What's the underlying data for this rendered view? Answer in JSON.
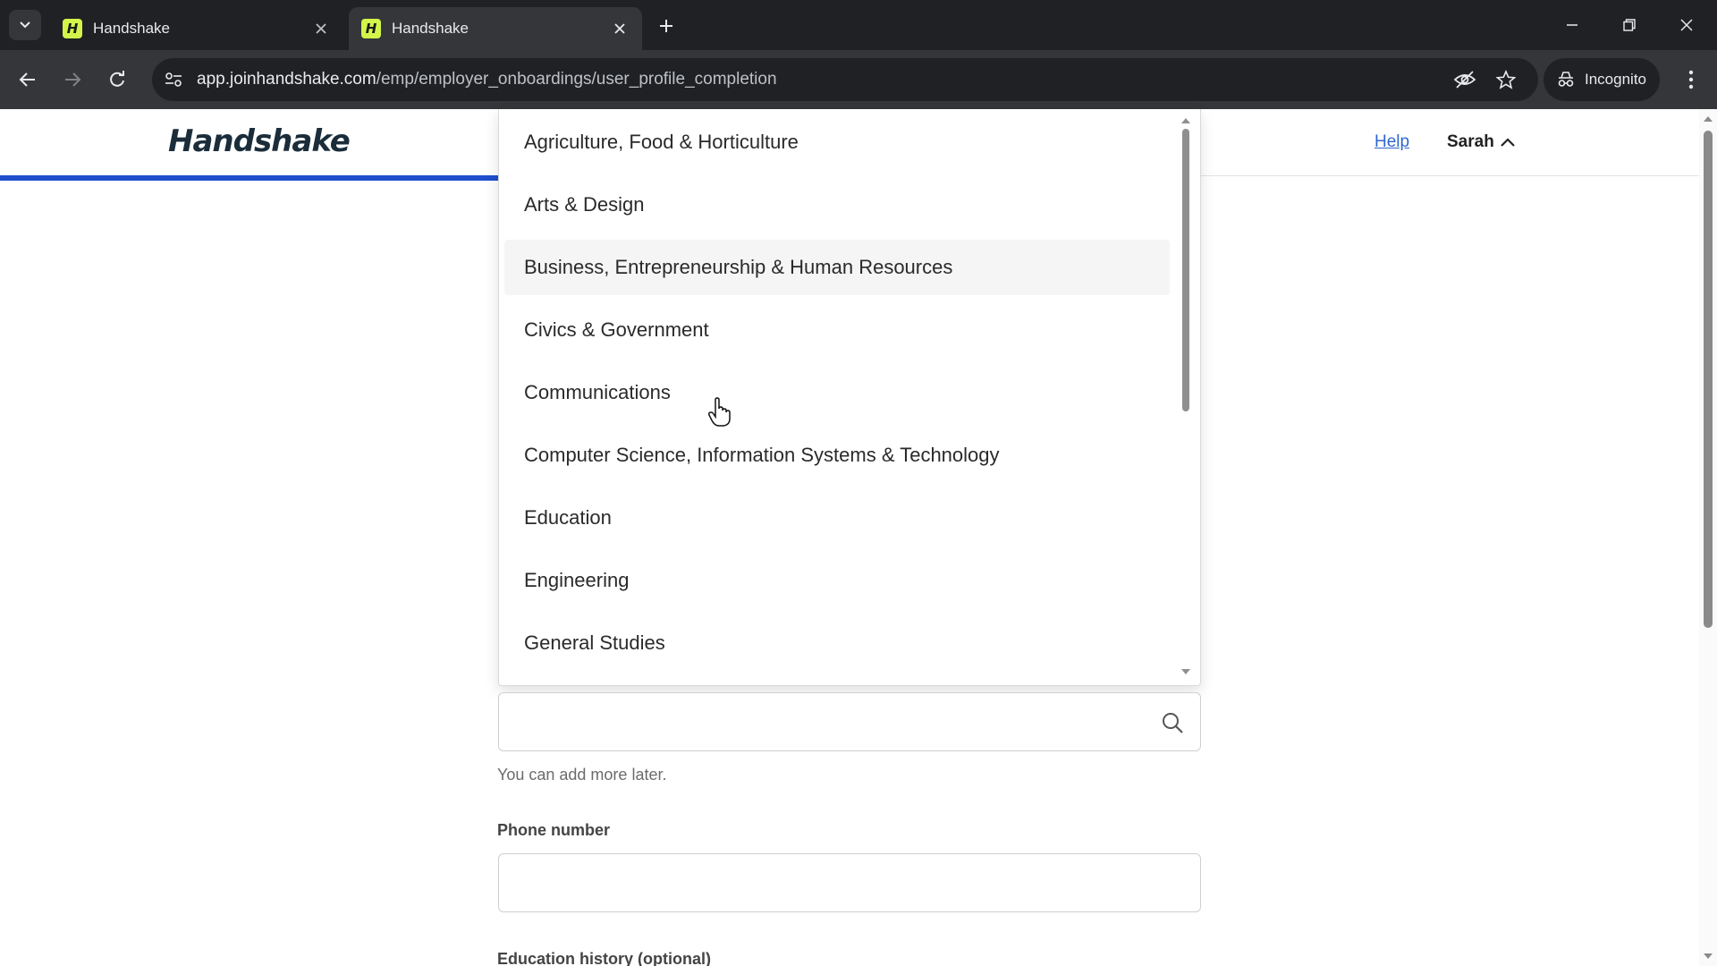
{
  "browser": {
    "tabs": [
      {
        "title": "Handshake",
        "favicon": "H",
        "active": false
      },
      {
        "title": "Handshake",
        "favicon": "H",
        "active": true
      }
    ],
    "url_host": "app.joinhandshake.com",
    "url_path": "/emp/employer_onboardings/user_profile_completion",
    "incognito_label": "Incognito"
  },
  "header": {
    "brand": "Handshake",
    "help_label": "Help",
    "user_name": "Sarah"
  },
  "dropdown": {
    "items": [
      "Agriculture, Food & Horticulture",
      "Arts & Design",
      "Business, Entrepreneurship & Human Resources",
      "Civics & Government",
      "Communications",
      "Computer Science, Information Systems & Technology",
      "Education",
      "Engineering",
      "General Studies"
    ],
    "hovered_index": 2
  },
  "form": {
    "search_value": "",
    "search_hint": "You can add more later.",
    "phone_label": "Phone number",
    "phone_value": "",
    "education_label": "Education history (optional)"
  },
  "colors": {
    "accent": "#1f4fcc",
    "link": "#2f66ce",
    "favicon": "#d3f44a"
  }
}
